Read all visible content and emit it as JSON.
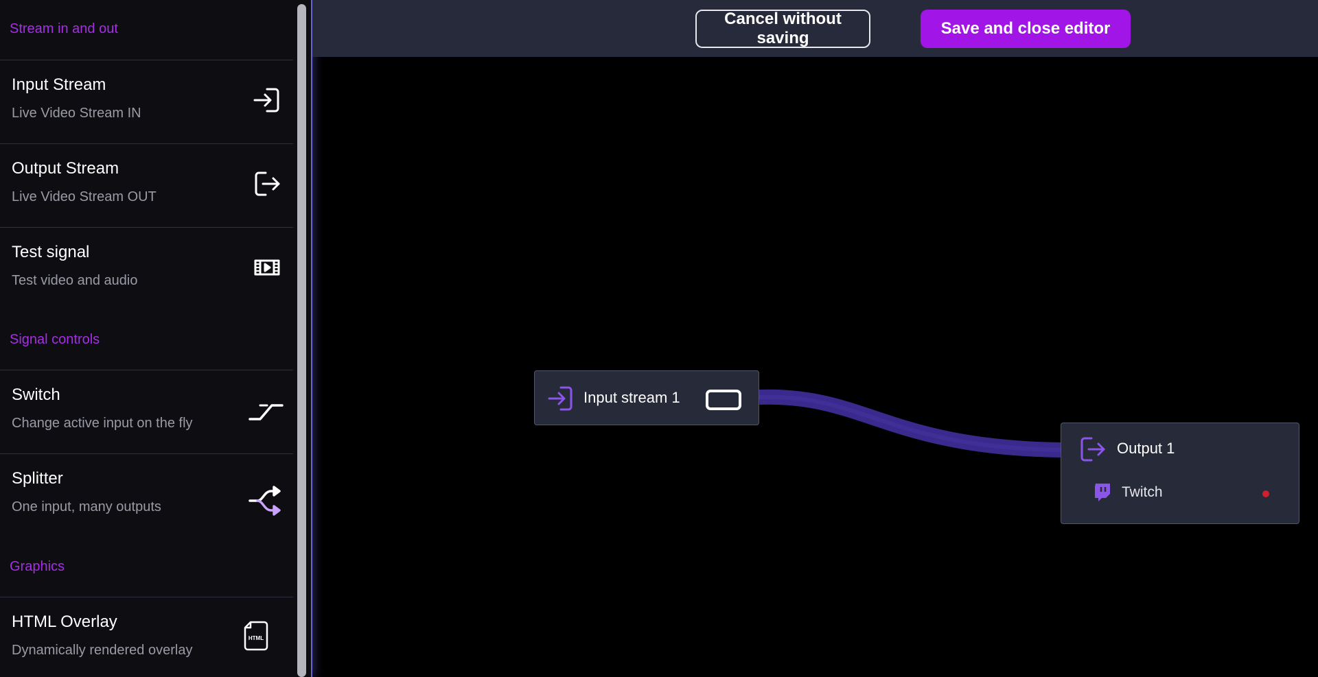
{
  "sidebar": {
    "sections": [
      {
        "title": "Stream in and out",
        "items": [
          {
            "title": "Input Stream",
            "subtitle": "Live Video Stream IN",
            "icon": "login-icon"
          },
          {
            "title": "Output Stream",
            "subtitle": "Live Video Stream OUT",
            "icon": "logout-icon"
          },
          {
            "title": "Test signal",
            "subtitle": "Test video and audio",
            "icon": "film-icon"
          }
        ]
      },
      {
        "title": "Signal controls",
        "items": [
          {
            "title": "Switch",
            "subtitle": "Change active input on the fly",
            "icon": "switch-icon"
          },
          {
            "title": "Splitter",
            "subtitle": "One input, many outputs",
            "icon": "split-arrows-icon"
          }
        ]
      },
      {
        "title": "Graphics",
        "items": [
          {
            "title": "HTML Overlay",
            "subtitle": "Dynamically rendered overlay",
            "icon": "html-file-icon",
            "icon_text": "HTML"
          }
        ]
      }
    ]
  },
  "toolbar": {
    "cancel_label": "Cancel without saving",
    "save_label": "Save and close editor"
  },
  "canvas": {
    "input_node": {
      "label": "Input stream 1",
      "icon": "login-icon"
    },
    "output_node": {
      "label": "Output 1",
      "icon": "logout-icon",
      "destination": {
        "label": "Twitch",
        "icon": "twitch-icon",
        "status_color": "#d21f2e"
      }
    }
  },
  "colors": {
    "accent": "#a116e6",
    "section_title": "#a62fe6",
    "node_icon": "#8a55e8",
    "link": "#3f2a95",
    "topbar": "#272a3a",
    "node_bg": "#272a38"
  }
}
